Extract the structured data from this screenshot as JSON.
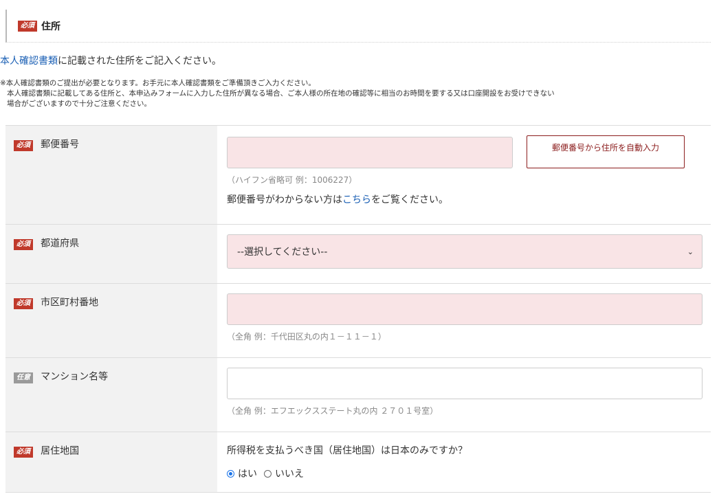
{
  "section": {
    "badge": "必須",
    "title": "住所"
  },
  "lead": {
    "link_text": "本人確認書類",
    "rest": "に記載された住所をご記入ください。"
  },
  "notes": [
    "※本人確認書類のご提出が必要となります。お手元に本人確認書類をご準備頂きご入力ください。",
    "本人確認書類に記載してある住所と、本申込みフォームに入力した住所が異なる場合、ご本人様の所在地の確認等に相当のお時間を要する又は口座開設をお受けできない",
    "場合がございますので十分ご注意ください。"
  ],
  "fields": {
    "postal": {
      "badge": "必須",
      "label": "郵便番号",
      "value": "",
      "button": "郵便番号から住所を自動入力",
      "hint": "（ハイフン省略可 例：1006227）",
      "help_pre": "郵便番号がわからない方は",
      "help_link": "こちら",
      "help_post": "をご覧ください。"
    },
    "prefecture": {
      "badge": "必須",
      "label": "都道府県",
      "selected": "--選択してください--"
    },
    "city": {
      "badge": "必須",
      "label": "市区町村番地",
      "value": "",
      "hint": "（全角 例：千代田区丸の内１－１１－１）"
    },
    "building": {
      "badge": "任意",
      "label": "マンション名等",
      "value": "",
      "hint": "（全角 例：エフエックスステート丸の内 ２７０１号室）"
    },
    "residence": {
      "badge": "必須",
      "label": "居住地国",
      "question": "所得税を支払うべき国（居住地国）は日本のみですか？",
      "options": [
        "はい",
        "いいえ"
      ],
      "selected": "はい"
    }
  },
  "colors": {
    "required_badge": "#c0392b",
    "optional_badge": "#9a9a9a",
    "link": "#1a5fb4",
    "input_required_bg": "#f9e4e6"
  },
  "icons": {
    "select_arrow": "chevron-down-icon"
  }
}
